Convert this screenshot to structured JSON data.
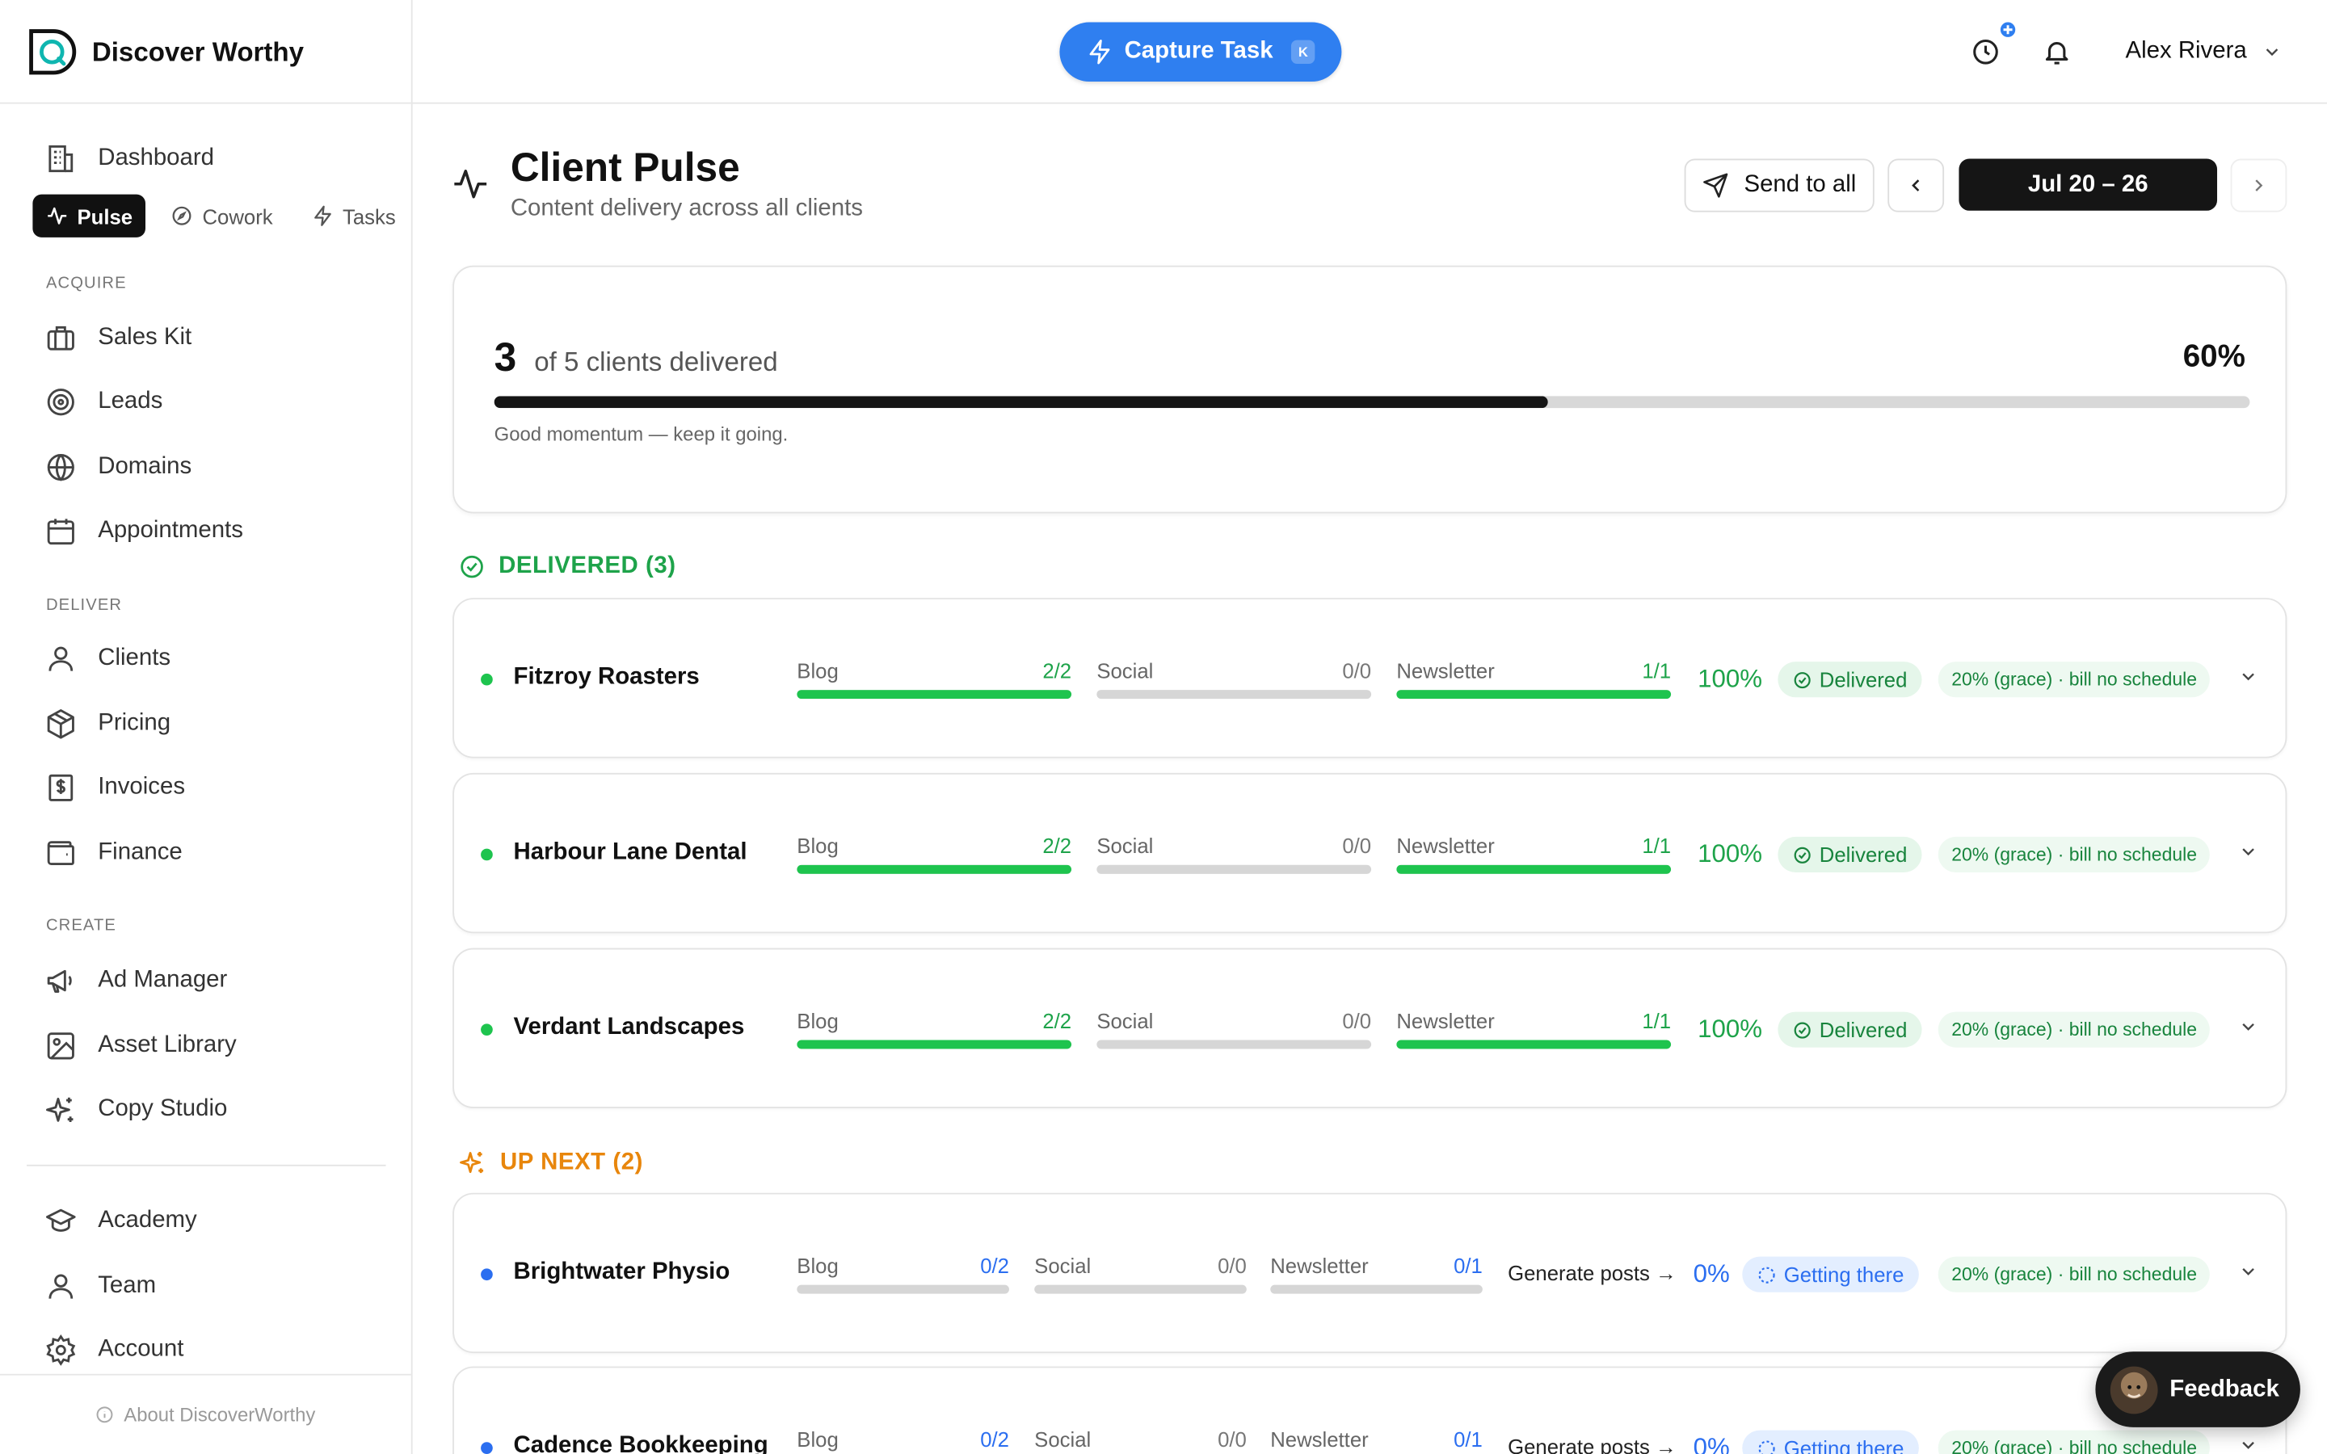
{
  "brand": {
    "name": "Discover Worthy"
  },
  "header": {
    "capture_label": "Capture Task",
    "capture_shortcut": "K",
    "user_name": "Alex Rivera"
  },
  "sidebar": {
    "dashboard": "Dashboard",
    "subtabs": [
      "Pulse",
      "Cowork",
      "Tasks"
    ],
    "sections": {
      "acquire": "ACQUIRE",
      "deliver": "DELIVER",
      "create": "CREATE"
    },
    "acquire_items": [
      "Sales Kit",
      "Leads",
      "Domains",
      "Appointments"
    ],
    "deliver_items": [
      "Clients",
      "Pricing",
      "Invoices",
      "Finance"
    ],
    "create_items": [
      "Ad Manager",
      "Asset Library",
      "Copy Studio"
    ],
    "bottom_items": [
      "Academy",
      "Team",
      "Account"
    ],
    "about": "About DiscoverWorthy"
  },
  "page": {
    "title": "Client Pulse",
    "subtitle": "Content delivery across all clients",
    "send_all": "Send to all",
    "date_range": "Jul 20 – 26"
  },
  "summary": {
    "delivered_count": "3",
    "delivered_text": "of 5 clients delivered",
    "percent": "60%",
    "progress": 0.6,
    "note": "Good momentum — keep it going."
  },
  "groups": {
    "delivered_label": "DELIVERED (3)",
    "up_next_label": "UP NEXT (2)"
  },
  "metric_labels": [
    "Blog",
    "Social",
    "Newsletter"
  ],
  "delivered_clients": [
    {
      "name": "Fitzroy Roasters",
      "blog": "2/2",
      "social": "0/0",
      "newsletter": "1/1",
      "percent": "100%",
      "status": "Delivered",
      "billing": "20% (grace) · bill no schedule"
    },
    {
      "name": "Harbour Lane Dental",
      "blog": "2/2",
      "social": "0/0",
      "newsletter": "1/1",
      "percent": "100%",
      "status": "Delivered",
      "billing": "20% (grace) · bill no schedule"
    },
    {
      "name": "Verdant Landscapes",
      "blog": "2/2",
      "social": "0/0",
      "newsletter": "1/1",
      "percent": "100%",
      "status": "Delivered",
      "billing": "20% (grace) · bill no schedule"
    }
  ],
  "upnext_clients": [
    {
      "name": "Brightwater Physio",
      "blog": "0/2",
      "social": "0/0",
      "newsletter": "0/1",
      "action": "Generate posts →",
      "percent": "0%",
      "status": "Getting there",
      "billing": "20% (grace) · bill no schedule"
    },
    {
      "name": "Cadence Bookkeeping",
      "blog": "0/2",
      "social": "0/0",
      "newsletter": "0/1",
      "action": "Generate posts →",
      "percent": "0%",
      "status": "Getting there",
      "billing": "20% (grace) · bill no schedule"
    }
  ],
  "feedback_label": "Feedback",
  "colors": {
    "accent_blue": "#2f7ff0",
    "success_green": "#1ea34a",
    "warning_orange": "#e8860c",
    "dark": "#151515"
  }
}
